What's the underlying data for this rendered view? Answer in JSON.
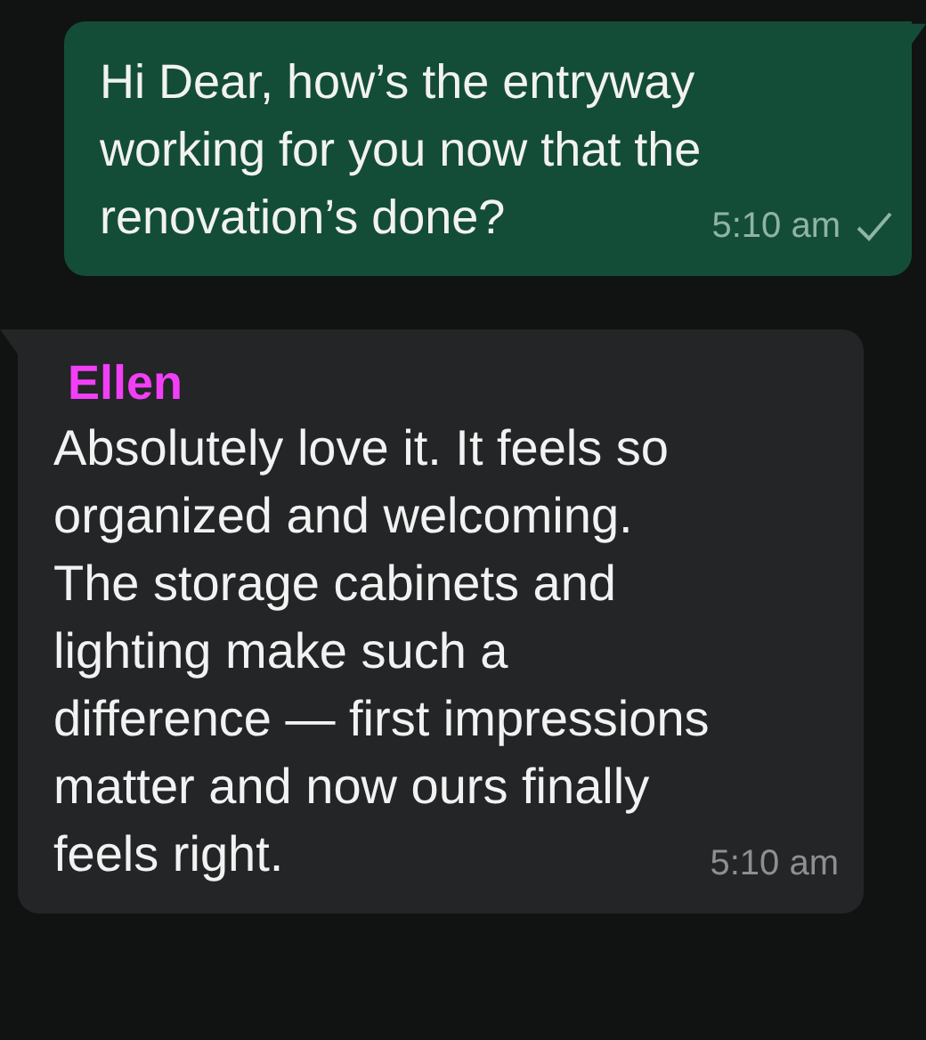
{
  "messages": [
    {
      "kind": "outgoing",
      "text": "Hi Dear, how’s the entryway working for you now that the renovation’s done?",
      "time": "5:10 am",
      "delivered": true
    },
    {
      "kind": "incoming",
      "sender": "Ellen",
      "color": "#f23ff7",
      "text": "Absolutely love it. It feels so organized and welcoming. The storage cabinets and lighting make such a difference — first impressions matter and now ours finally feels right.",
      "time": "5:10 am"
    }
  ]
}
